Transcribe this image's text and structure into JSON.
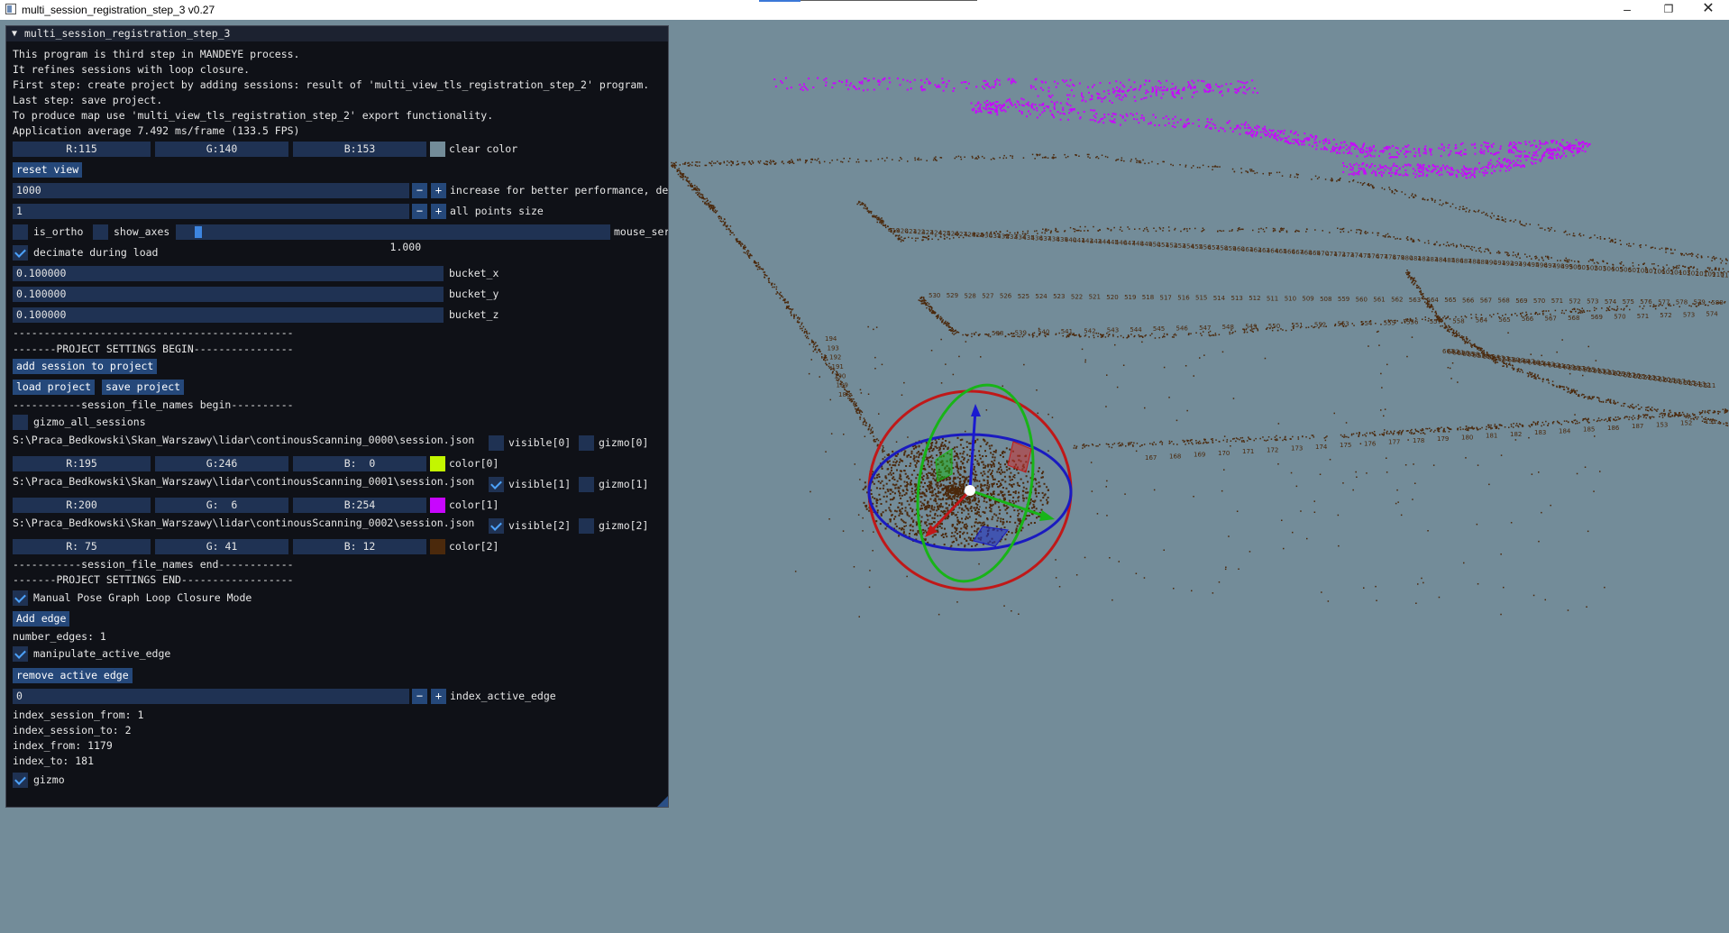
{
  "window": {
    "title": "multi_session_registration_step_3 v0.27"
  },
  "panel": {
    "title": "multi_session_registration_step_3",
    "intro": [
      "This program is third step in MANDEYE process.",
      "It refines sessions with loop closure.",
      "First step: create project by adding sessions: result of 'multi_view_tls_registration_step_2' program.",
      "Last step: save project.",
      "To produce map use 'multi_view_tls_registration_step_2' export functionality.",
      "Application average 7.492 ms/frame (133.5 FPS)"
    ],
    "clear_color": {
      "r": "R:115",
      "g": "G:140",
      "b": "B:153",
      "label": "clear color",
      "swatch": "#738c99"
    },
    "reset_view": "reset view",
    "decimation": {
      "value": "1000",
      "label": "increase for better performance, de"
    },
    "point_size": {
      "value": "1",
      "label": "all points size"
    },
    "is_ortho": "is_ortho",
    "show_axes": "show_axes",
    "mouse_sensitivity": {
      "value": "1.000",
      "label": "mouse_ser",
      "fraction": 0.05
    },
    "decimate_during_load": "decimate during load",
    "bucket_x": {
      "value": "0.100000",
      "label": "bucket_x"
    },
    "bucket_y": {
      "value": "0.100000",
      "label": "bucket_y"
    },
    "bucket_z": {
      "value": "0.100000",
      "label": "bucket_z"
    },
    "separator": "---------------------------------------------",
    "project_begin": "-------PROJECT SETTINGS BEGIN----------------",
    "add_session": "add session to project",
    "load_project": "load project",
    "save_project": "save project",
    "names_begin": "-----------session_file_names begin----------",
    "gizmo_all": "gizmo_all_sessions",
    "sessions": [
      {
        "path": "S:\\Praca_Bedkowski\\Skan_Warszawy\\lidar\\continousScanning_0000\\session.json",
        "visible": "visible[0]",
        "visible_on": false,
        "gizmo": "gizmo[0]",
        "r": "R:195",
        "g": "G:246",
        "b": "B:  0",
        "color_label": "color[0]",
        "color": "#c3f600"
      },
      {
        "path": "S:\\Praca_Bedkowski\\Skan_Warszawy\\lidar\\continousScanning_0001\\session.json",
        "visible": "visible[1]",
        "visible_on": true,
        "gizmo": "gizmo[1]",
        "r": "R:200",
        "g": "G:  6",
        "b": "B:254",
        "color_label": "color[1]",
        "color": "#c806fe"
      },
      {
        "path": "S:\\Praca_Bedkowski\\Skan_Warszawy\\lidar\\continousScanning_0002\\session.json",
        "visible": "visible[2]",
        "visible_on": true,
        "gizmo": "gizmo[2]",
        "r": "R: 75",
        "g": "G: 41",
        "b": "B: 12",
        "color_label": "color[2]",
        "color": "#4b290c"
      }
    ],
    "names_end": "-----------session_file_names end------------",
    "project_end": "-------PROJECT SETTINGS END------------------",
    "manual_mode": "Manual Pose Graph Loop Closure Mode",
    "add_edge": "Add edge",
    "number_edges": "number_edges: 1",
    "manipulate_active_edge": "manipulate_active_edge",
    "remove_active_edge": "remove active edge",
    "index_active_edge": {
      "value": "0",
      "label": "index_active_edge"
    },
    "index_session_from": "index_session_from: 1",
    "index_session_to": "index_session_to: 2",
    "index_from": "index_from: 1179",
    "index_to": "index_to: 181",
    "gizmo": "gizmo"
  },
  "scene": {
    "background": "#738c99",
    "purple_points": "#c806fe",
    "brown_points": "#4b290c",
    "trajectory_numbers_top": [
      "419",
      "420",
      "421",
      "422",
      "423",
      "424",
      "425",
      "426",
      "427",
      "428",
      "429",
      "430",
      "431",
      "432",
      "433",
      "434",
      "435",
      "436",
      "437",
      "438",
      "439",
      "440",
      "441",
      "442",
      "443",
      "444",
      "445",
      "446",
      "447",
      "448",
      "449",
      "450",
      "451",
      "452",
      "453",
      "454",
      "455",
      "456",
      "457",
      "458",
      "459",
      "460",
      "461",
      "462",
      "463",
      "464",
      "465",
      "466",
      "467",
      "468",
      "469",
      "470",
      "471",
      "472",
      "473",
      "474",
      "475",
      "476",
      "477",
      "478",
      "479",
      "480",
      "481",
      "482",
      "483",
      "484",
      "485",
      "486",
      "487",
      "488",
      "489",
      "490",
      "491",
      "492",
      "493",
      "494",
      "495",
      "496",
      "497",
      "498",
      "499",
      "500",
      "501",
      "502",
      "503",
      "504",
      "505",
      "506",
      "507",
      "108",
      "107",
      "106",
      "105",
      "104",
      "103",
      "102",
      "101",
      "109",
      "110",
      "111",
      "112"
    ],
    "trajectory_numbers_mid": [
      "530",
      "529",
      "528",
      "527",
      "526",
      "525",
      "524",
      "523",
      "522",
      "521",
      "520",
      "519",
      "518",
      "517",
      "516",
      "515",
      "514",
      "513",
      "512",
      "511",
      "510",
      "509",
      "508",
      "559",
      "560",
      "561",
      "562",
      "563",
      "564",
      "565",
      "566",
      "567",
      "568",
      "569",
      "570",
      "571",
      "572",
      "573",
      "574",
      "575",
      "576",
      "577",
      "578",
      "579",
      "580",
      "581"
    ],
    "trajectory_numbers_low": [
      "538",
      "539",
      "540",
      "541",
      "542",
      "543",
      "544",
      "545",
      "546",
      "547",
      "548",
      "549",
      "550",
      "551",
      "552",
      "553",
      "554",
      "555",
      "556",
      "557",
      "558",
      "564",
      "565",
      "566",
      "567",
      "568",
      "569",
      "570",
      "571",
      "572",
      "573",
      "574",
      "575"
    ],
    "trajectory_numbers_right": [
      "663",
      "662",
      "661",
      "660",
      "659",
      "658",
      "657",
      "656",
      "655",
      "654",
      "653",
      "652",
      "651",
      "650",
      "649",
      "648",
      "647",
      "646",
      "645",
      "644",
      "643",
      "642",
      "641",
      "640",
      "639",
      "638",
      "637",
      "636",
      "635",
      "634",
      "633",
      "632",
      "631",
      "630",
      "629",
      "628",
      "627",
      "626",
      "625",
      "624",
      "623",
      "622",
      "621",
      "620",
      "619",
      "618",
      "617",
      "616",
      "615",
      "614",
      "613",
      "612",
      "611"
    ],
    "trajectory_numbers_left": [
      "194",
      "193",
      "192",
      "191",
      "190",
      "189",
      "188"
    ],
    "trajectory_numbers_bottom": [
      "167",
      "168",
      "169",
      "170",
      "171",
      "172",
      "173",
      "174",
      "175",
      "176",
      "177",
      "178",
      "179",
      "180",
      "181",
      "182",
      "183",
      "184",
      "185",
      "186",
      "187",
      "153",
      "152",
      "151",
      "150"
    ]
  }
}
